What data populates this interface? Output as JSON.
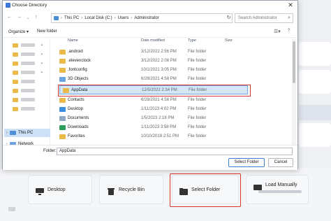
{
  "window": {
    "title": "Choose Directory",
    "close_glyph": "✕"
  },
  "nav": {
    "back": "←",
    "forward": "→",
    "up": "↑",
    "path": [
      "This PC",
      "Local Disk (C:)",
      "Users",
      "Administrator"
    ],
    "refresh_glyph": "↻",
    "search_placeholder": "Search Administrator"
  },
  "commands": {
    "organize": "Organize ▾",
    "new_folder": "New folder"
  },
  "left_pane": {
    "this_pc": "This PC",
    "network": "Network"
  },
  "columns": {
    "name": "Name",
    "date": "Date modified",
    "type": "Type",
    "size": "Size"
  },
  "files": [
    {
      "name": ".android",
      "date": "3/12/2022 2:56 PM",
      "type": "File folder",
      "icon": "folder-icon"
    },
    {
      "name": ".elevenclock",
      "date": "3/12/2022 2:08 PM",
      "type": "File folder",
      "icon": "folder-icon"
    },
    {
      "name": ".fontconfig",
      "date": "10/1/2021 3:05 PM",
      "type": "File folder",
      "icon": "folder-icon"
    },
    {
      "name": "3D Objects",
      "date": "6/28/2021 4:58 PM",
      "type": "File folder",
      "icon": "3d-objects-icon"
    },
    {
      "name": "AppData",
      "date": "12/5/2022 2:34 PM",
      "type": "File folder",
      "icon": "folder-icon"
    },
    {
      "name": "Contacts",
      "date": "6/28/2021 4:58 PM",
      "type": "File folder",
      "icon": "contacts-icon"
    },
    {
      "name": "Desktop",
      "date": "1/11/2023 4:02 PM",
      "type": "File folder",
      "icon": "desktop-icon"
    },
    {
      "name": "Documents",
      "date": "1/5/2023 2:18 PM",
      "type": "File folder",
      "icon": "documents-icon"
    },
    {
      "name": "Downloads",
      "date": "1/11/2023 3:58 PM",
      "type": "File folder",
      "icon": "downloads-icon"
    },
    {
      "name": "Favorites",
      "date": "10/10/2019 2:51 PM",
      "type": "File folder",
      "icon": "favorites-icon"
    }
  ],
  "footer": {
    "folder_label": "Folder:",
    "folder_value": "AppData",
    "select_button": "Select Folder",
    "cancel_button": "Cancel"
  },
  "background_app": {
    "desktop": "Desktop",
    "recycle_bin": "Recycle Bin",
    "select_folder": "Select Folder",
    "load_manually": "Load Manually"
  },
  "colors": {
    "folder": "#e9b94a",
    "selection": "#d3e6fa",
    "highlight_box": "#d9352b",
    "accent": "#3b78d8"
  }
}
